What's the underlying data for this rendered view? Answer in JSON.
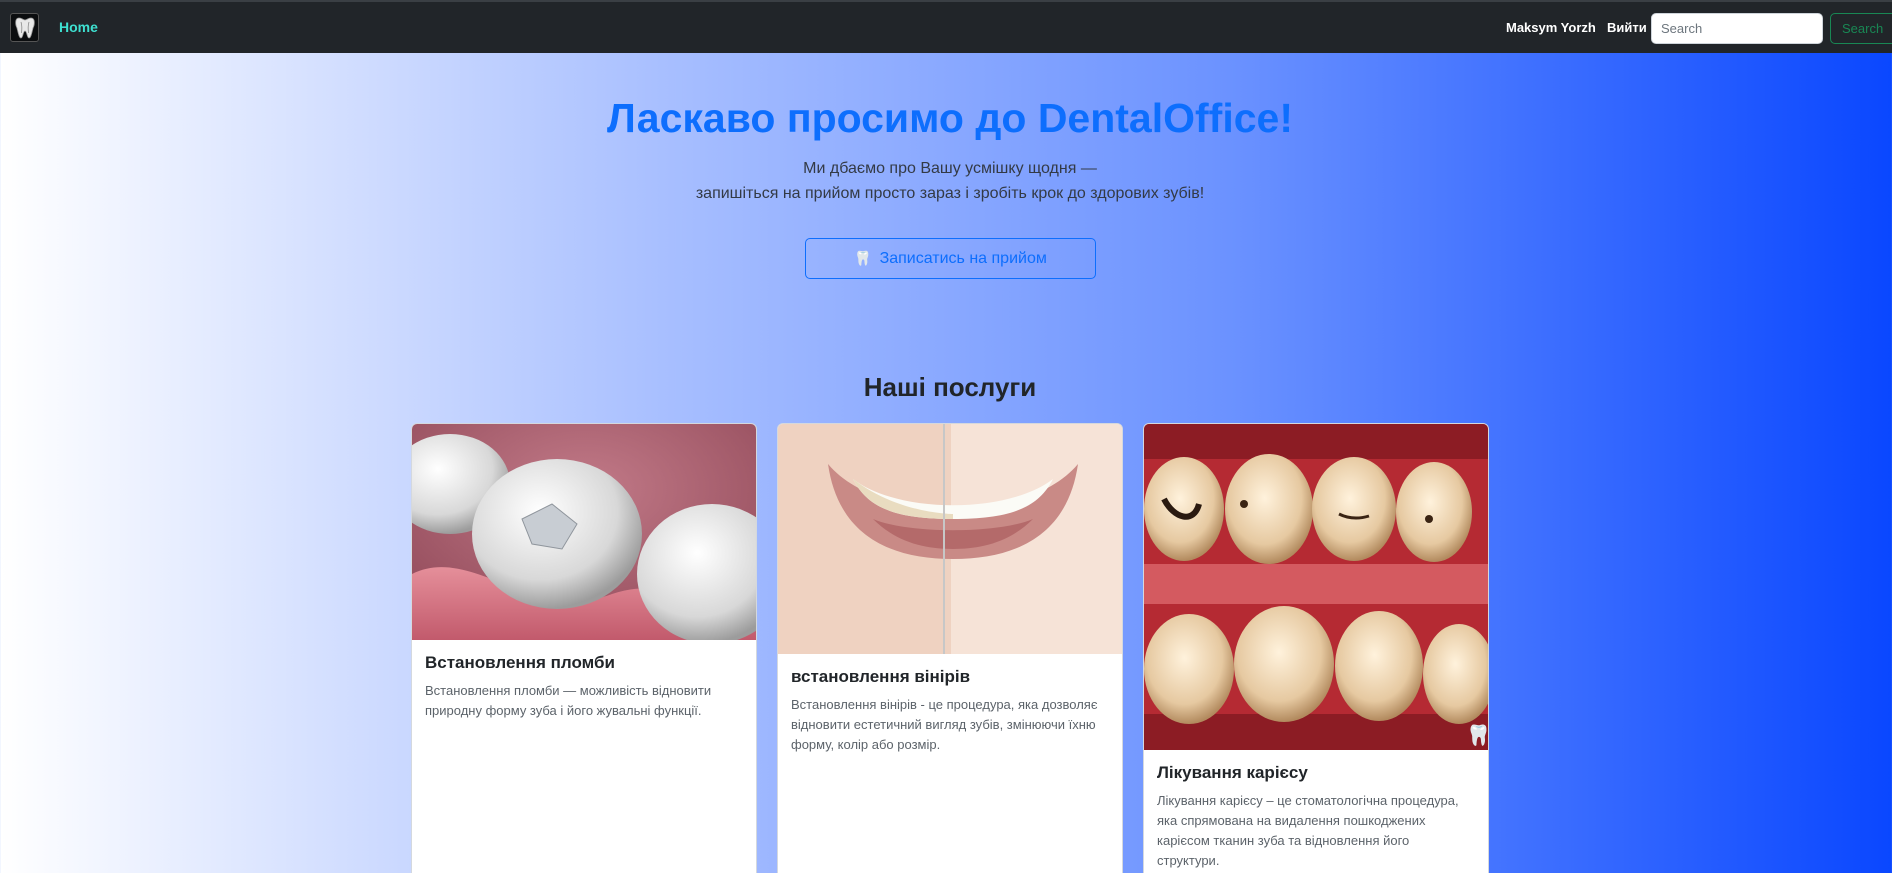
{
  "navbar": {
    "logo_icon": "tooth-logo-icon",
    "home_label": "Home",
    "user_name": "Maksym Yorzh",
    "logout_label": "Вийти",
    "search_placeholder": "Search",
    "search_button_label": "Search"
  },
  "hero": {
    "title": "Ласкаво просимо до DentalOffice!",
    "subtitle_line1": "Ми дбаємо про Вашу усмішку щодня —",
    "subtitle_line2": "запишіться на прийом просто зараз і зробіть крок до здорових зубів!",
    "book_button_icon": "🦷",
    "book_button_label": "Записатись на прийом"
  },
  "services": {
    "title": "Наші послуги",
    "cards": [
      {
        "title": "Встановлення пломби",
        "text": "Встановлення пломби — можливість відновити природну форму зуба і його жувальні функції.",
        "image": "tooth-filling-illustration"
      },
      {
        "title": "встановлення вінірів",
        "text": "Встановлення вінірів - це процедура, яка дозволяє відновити естетичний вигляд зубів, змінюючи їхню форму, колір або розмір.",
        "image": "smile-veneers-photo"
      },
      {
        "title": "Лікування карієсу",
        "text": "Лікування карієсу – це стоматологічна процедура, яка спрямована на видалення пошкоджених карієсом тканин зуба та відновлення його структури.",
        "image": "caries-teeth-photo"
      }
    ]
  },
  "colors": {
    "navbar_bg": "#212529",
    "home_link": "#3ee0d0",
    "primary": "#0d6efd",
    "success": "#198754"
  }
}
